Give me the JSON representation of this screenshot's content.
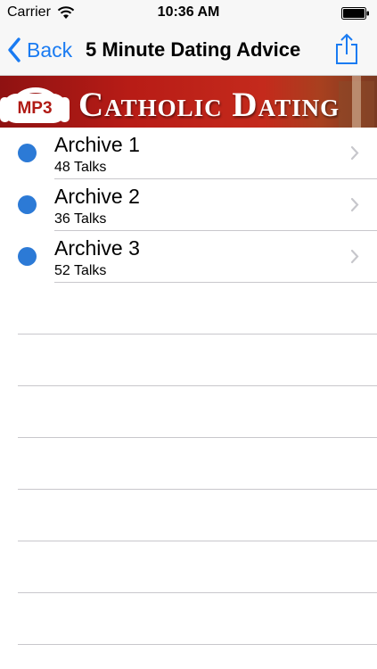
{
  "status_bar": {
    "carrier": "Carrier",
    "time": "10:36 AM"
  },
  "nav": {
    "back_label": "Back",
    "title": "5 Minute Dating Advice",
    "accent_color": "#1a7bf2"
  },
  "banner": {
    "badge": "MP3",
    "title": "Catholic Dating",
    "color": "#b81c16"
  },
  "list": {
    "items": [
      {
        "title": "Archive 1",
        "subtitle": "48 Talks"
      },
      {
        "title": "Archive 2",
        "subtitle": "36 Talks"
      },
      {
        "title": "Archive 3",
        "subtitle": "52 Talks"
      }
    ],
    "dot_color": "#2c7ad6"
  },
  "icons": {
    "wifi": "wifi-icon",
    "battery": "battery-icon",
    "back": "chevron-left-icon",
    "share": "share-icon",
    "disclosure": "chevron-right-icon",
    "headphones": "headphones-icon"
  }
}
